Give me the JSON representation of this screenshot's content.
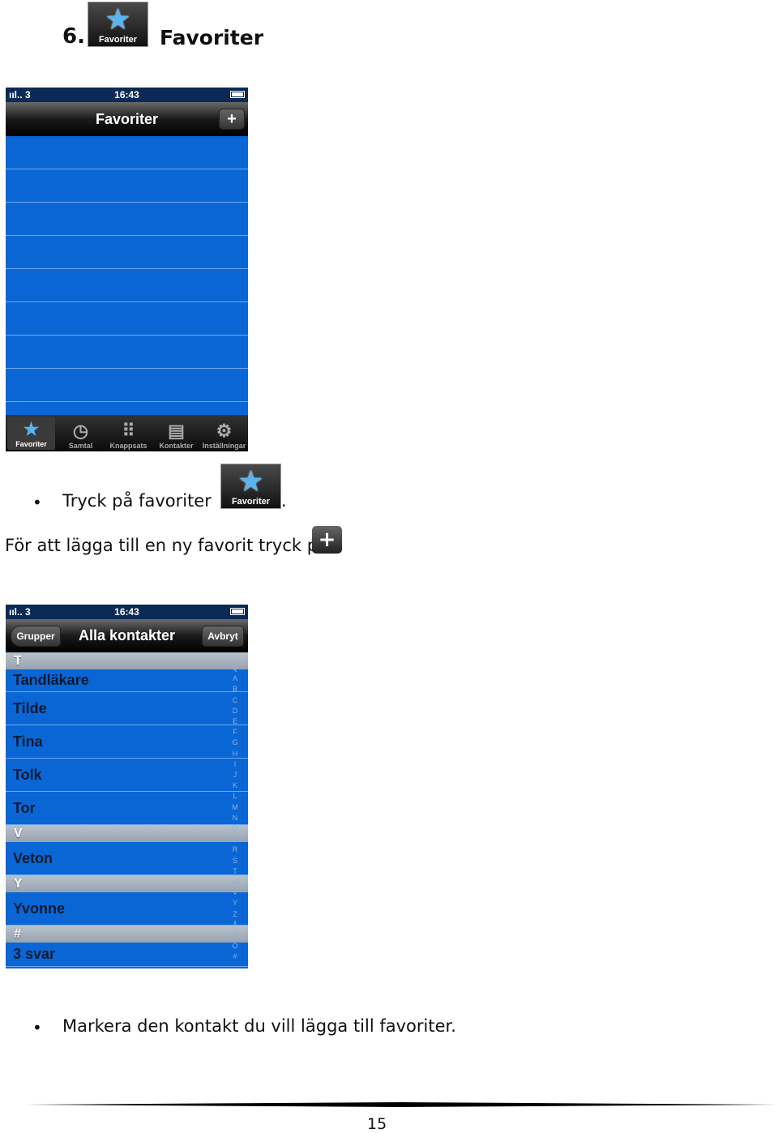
{
  "heading": {
    "number": "6.",
    "title": "Favoriter",
    "icon_label": "Favoriter"
  },
  "phone1": {
    "status": {
      "signal": "ııl.. 3",
      "time": "16:43"
    },
    "nav_title": "Favoriter",
    "add_button": "+",
    "tabs": [
      {
        "label": "Favoriter",
        "icon": "star-icon"
      },
      {
        "label": "Samtal",
        "icon": "clock-icon"
      },
      {
        "label": "Knappsats",
        "icon": "keypad-icon"
      },
      {
        "label": "Kontakter",
        "icon": "contact-card-icon"
      },
      {
        "label": "Inställningar",
        "icon": "gears-icon"
      }
    ]
  },
  "bullet1": {
    "text": "Tryck på favoriter",
    "icon_label": "Favoriter",
    "suffix": "."
  },
  "line2": {
    "text": "För att lägga till en ny favorit tryck på",
    "button": "+"
  },
  "phone2": {
    "status": {
      "signal": "ııl.. 3",
      "time": "16:43"
    },
    "back_button": "Grupper",
    "nav_title": "Alla kontakter",
    "cancel_button": "Avbryt",
    "sections": [
      {
        "h": "T",
        "rows": [
          "Tandläkare",
          "Tilde",
          "Tina",
          "Tolk",
          "Tor"
        ]
      },
      {
        "h": "V",
        "rows": [
          "Veton"
        ]
      },
      {
        "h": "Y",
        "rows": [
          "Yvonne"
        ]
      },
      {
        "h": "#",
        "rows": [
          "3 svar"
        ]
      }
    ],
    "index": [
      "Q",
      "A",
      "B",
      "C",
      "D",
      "E",
      "F",
      "G",
      "H",
      "I",
      "J",
      "K",
      "L",
      "M",
      "N",
      "O",
      "P",
      "R",
      "S",
      "T",
      "U",
      "V",
      "Y",
      "Z",
      "Å",
      "Ä",
      "Ö",
      "#"
    ]
  },
  "bullet2": {
    "text": "Markera den kontakt du vill lägga till favoriter."
  },
  "page_number": "15"
}
